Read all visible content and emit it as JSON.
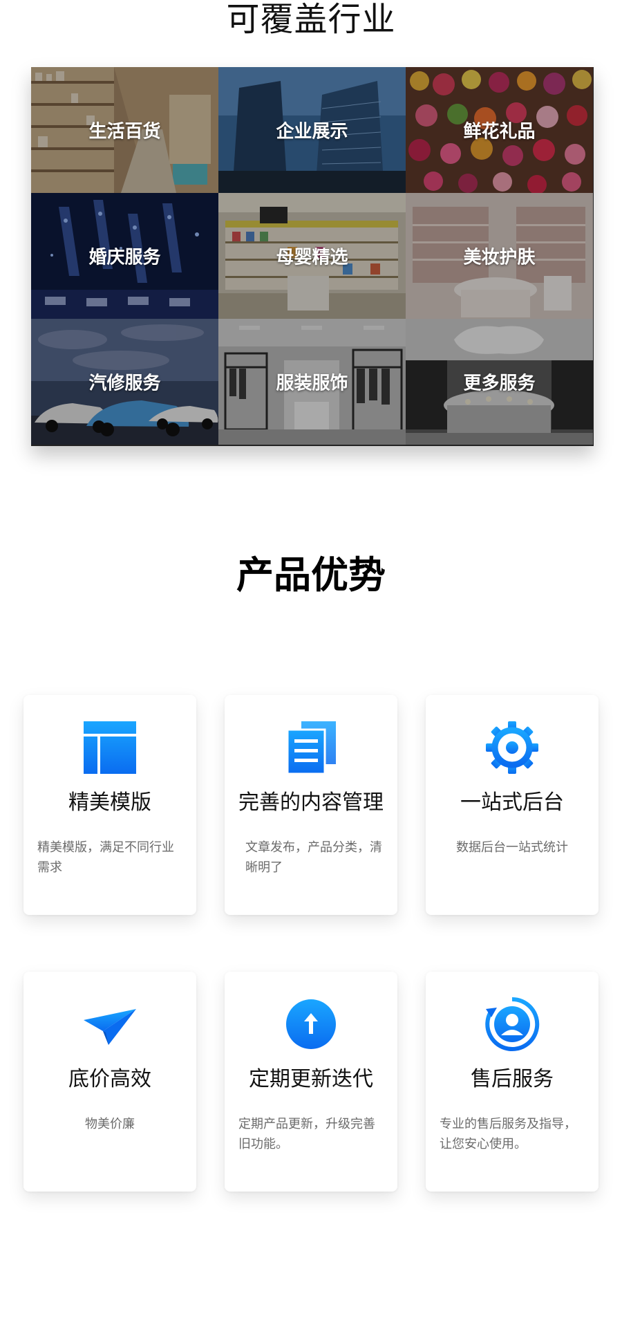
{
  "industries": {
    "title": "可覆盖行业",
    "tiles": [
      {
        "label": "生活百货",
        "icon": "store-shelves-photo"
      },
      {
        "label": "企业展示",
        "icon": "office-buildings-photo"
      },
      {
        "label": "鲜花礼品",
        "icon": "flowers-photo"
      },
      {
        "label": "婚庆服务",
        "icon": "wedding-stage-photo"
      },
      {
        "label": "母婴精选",
        "icon": "baby-store-photo"
      },
      {
        "label": "美妆护肤",
        "icon": "cosmetics-store-photo"
      },
      {
        "label": "汽修服务",
        "icon": "sports-cars-photo"
      },
      {
        "label": "服装服饰",
        "icon": "clothing-store-photo"
      },
      {
        "label": "更多服务",
        "icon": "showroom-photo"
      }
    ]
  },
  "advantages": {
    "title": "产品优势",
    "cards": [
      {
        "title": "精美模版",
        "desc": "精美模版，满足不同行业需求",
        "icon": "template-layout-icon"
      },
      {
        "title": "完善的内容管理",
        "desc": "文章发布，产品分类，清晰明了",
        "icon": "documents-icon"
      },
      {
        "title": "一站式后台",
        "desc": "数据后台一站式统计",
        "icon": "gear-icon"
      },
      {
        "title": "底价高效",
        "desc": "物美价廉",
        "icon": "paper-plane-icon"
      },
      {
        "title": "定期更新迭代",
        "desc": "定期产品更新，升级完善旧功能。",
        "icon": "upload-arrow-icon"
      },
      {
        "title": "售后服务",
        "desc": "专业的售后服务及指导，让您安心使用。",
        "icon": "customer-service-icon"
      }
    ]
  },
  "colors": {
    "accent_start": "#1aa6ff",
    "accent_end": "#0a6cf0"
  }
}
